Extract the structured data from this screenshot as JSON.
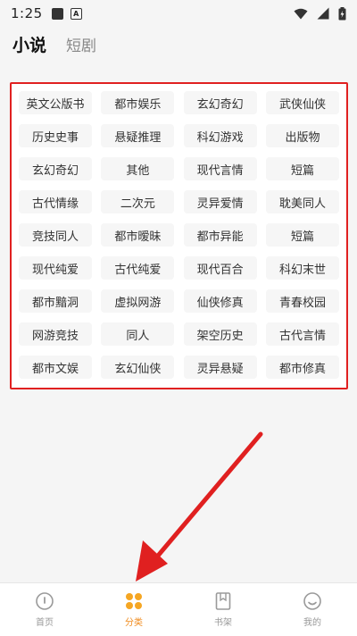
{
  "status": {
    "time": "1:25",
    "notif_letter": "A"
  },
  "tabs": [
    {
      "label": "小说",
      "active": true
    },
    {
      "label": "短剧",
      "active": false
    }
  ],
  "genres": [
    "英文公版书",
    "都市娱乐",
    "玄幻奇幻",
    "武侠仙侠",
    "历史史事",
    "悬疑推理",
    "科幻游戏",
    "出版物",
    "玄幻奇幻",
    "其他",
    "现代言情",
    "短篇",
    "古代情缘",
    "二次元",
    "灵异爱情",
    "耽美同人",
    "竞技同人",
    "都市暧昧",
    "都市异能",
    "短篇",
    "现代纯爱",
    "古代纯爱",
    "现代百合",
    "科幻末世",
    "都市黯洞",
    "虚拟网游",
    "仙侠修真",
    "青春校园",
    "网游竞技",
    "同人",
    "架空历史",
    "古代言情",
    "都市文娱",
    "玄幻仙侠",
    "灵异悬疑",
    "都市修真"
  ],
  "nav": [
    {
      "label": "首页",
      "icon": "home-icon",
      "active": false
    },
    {
      "label": "分类",
      "icon": "category-icon",
      "active": true
    },
    {
      "label": "书架",
      "icon": "bookshelf-icon",
      "active": false
    },
    {
      "label": "我的",
      "icon": "profile-icon",
      "active": false
    }
  ],
  "colors": {
    "highlight": "#e02020",
    "accent": "#f08a1c",
    "background": "#f5f5f5"
  }
}
